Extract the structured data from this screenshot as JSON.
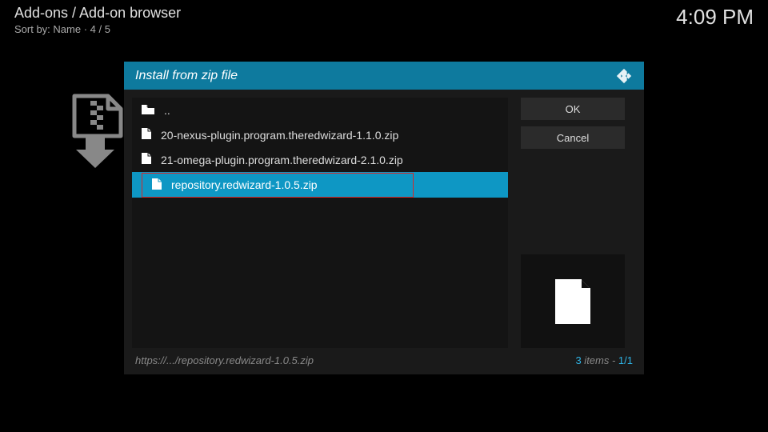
{
  "header": {
    "breadcrumb": "Add-ons / Add-on browser",
    "sortby": "Sort by: Name  ·  4 / 5",
    "clock": "4:09 PM"
  },
  "dialog": {
    "title": "Install from zip file",
    "parent_dir": "..",
    "files": {
      "f0": "20-nexus-plugin.program.theredwizard-1.1.0.zip",
      "f1": "21-omega-plugin.program.theredwizard-2.1.0.zip",
      "f2": "repository.redwizard-1.0.5.zip"
    },
    "buttons": {
      "ok": "OK",
      "cancel": "Cancel"
    },
    "footer": {
      "path": "https://.../repository.redwizard-1.0.5.zip",
      "count": "3",
      "items_word": " items - ",
      "page": "1/1"
    }
  }
}
